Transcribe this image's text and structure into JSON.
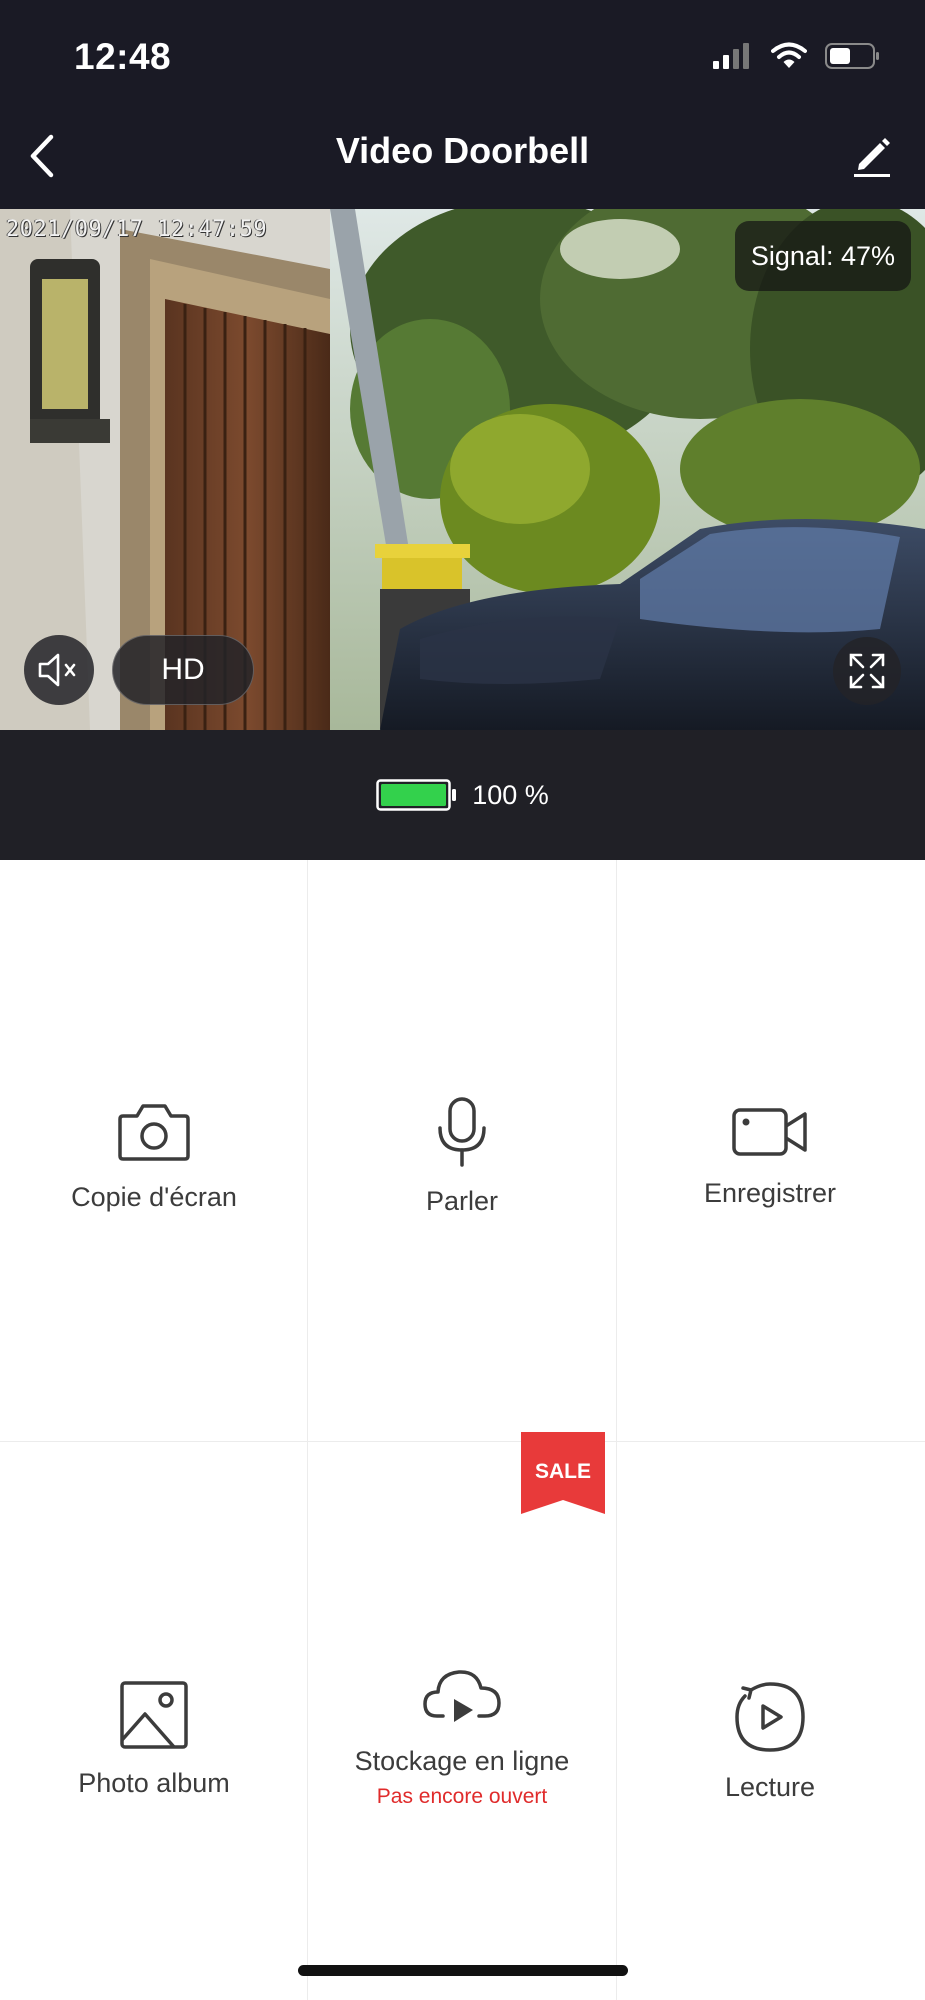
{
  "status_bar": {
    "time": "12:48"
  },
  "nav": {
    "title": "Video Doorbell"
  },
  "video": {
    "timestamp": "2021/09/17 12:47:59",
    "signal_label": "Signal: 47%",
    "quality_label": "HD"
  },
  "battery": {
    "percent_label": "100 %",
    "level": 1.0,
    "color": "#33d14c"
  },
  "actions": [
    {
      "label": "Copie d'écran",
      "icon": "camera-icon"
    },
    {
      "label": "Parler",
      "icon": "microphone-icon"
    },
    {
      "label": "Enregistrer",
      "icon": "video-camera-icon"
    },
    {
      "label": "Photo album",
      "icon": "image-icon"
    },
    {
      "label": "Stockage en ligne",
      "sublabel": "Pas encore ouvert",
      "icon": "cloud-play-icon",
      "badge": "SALE"
    },
    {
      "label": "Lecture",
      "icon": "replay-icon"
    }
  ],
  "colors": {
    "header_bg": "#1a1a25",
    "sale_red": "#e83a3a",
    "sublabel_red": "#e02b2b"
  }
}
